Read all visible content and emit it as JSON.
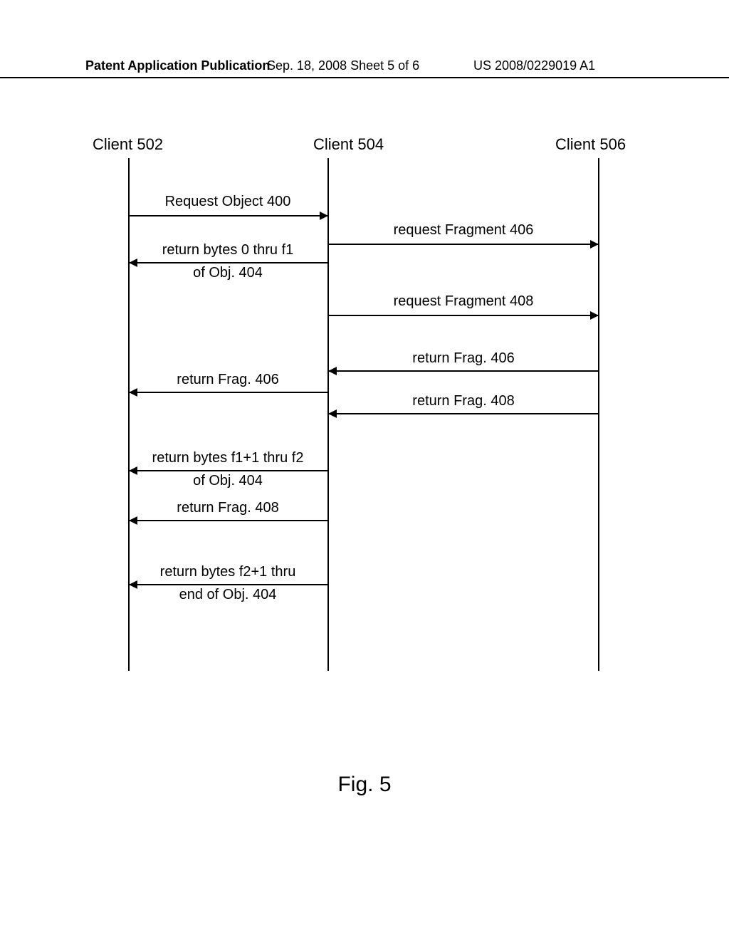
{
  "header": {
    "left": "Patent Application Publication",
    "mid": "Sep. 18, 2008  Sheet 5 of 6",
    "right": "US 2008/0229019 A1"
  },
  "participants": {
    "p1": "Client 502",
    "p2": "Client 504",
    "p3": "Client 506"
  },
  "messages": {
    "m1": "Request Object 400",
    "m2_l1": "return bytes 0 thru f1",
    "m2_l2": "of Obj. 404",
    "m3": "request Fragment 406",
    "m4": "request Fragment 408",
    "m5": "return Frag. 406",
    "m6": "return Frag. 406",
    "m7": "return Frag. 408",
    "m8_l1": "return bytes f1+1 thru f2",
    "m8_l2": "of Obj. 404",
    "m9": "return Frag. 408",
    "m10_l1": "return bytes f2+1 thru",
    "m10_l2": "end of Obj. 404"
  },
  "figure_caption": "Fig. 5"
}
